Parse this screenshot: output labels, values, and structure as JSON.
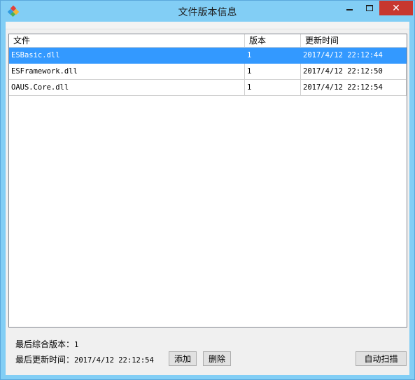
{
  "window": {
    "title": "文件版本信息",
    "close_glyph": "✕",
    "icon": "app-icon"
  },
  "listview": {
    "columns": [
      "文件",
      "版本",
      "更新时间"
    ],
    "rows": [
      {
        "file": "ESBasic.dll",
        "version": "1",
        "updated": "2017/4/12 22:12:44",
        "selected": true
      },
      {
        "file": "ESFramework.dll",
        "version": "1",
        "updated": "2017/4/12 22:12:50",
        "selected": false
      },
      {
        "file": "OAUS.Core.dll",
        "version": "1",
        "updated": "2017/4/12 22:12:54",
        "selected": false
      }
    ]
  },
  "footer": {
    "latest_version_label": "最后综合版本：",
    "latest_version_value": "1",
    "latest_update_label": "最后更新时间：",
    "latest_update_value": "2017/4/12 22:12:54"
  },
  "buttons": {
    "add": "添加",
    "delete": "删除",
    "auto_scan": "自动扫描"
  },
  "colors": {
    "title_bar": "#82cef5",
    "close_button": "#c7372f",
    "selection": "#3399ff"
  }
}
